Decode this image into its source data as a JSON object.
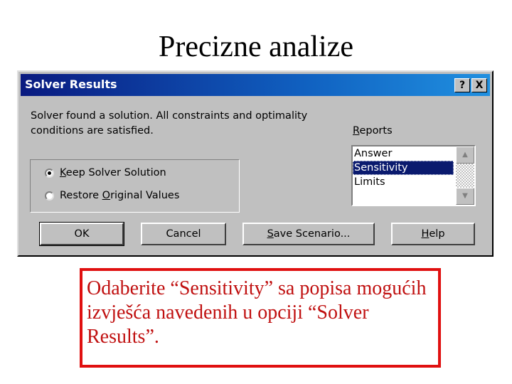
{
  "slide": {
    "title": "Precizne analize",
    "note": "Odaberite “Sensitivity” sa popisa mogućih izvješća navedenih u opciji “Solver Results”."
  },
  "dialog": {
    "title": "Solver Results",
    "help_icon": "?",
    "close_icon": "X",
    "message_line1": "Solver found a solution.  All constraints and optimality",
    "message_line2": "conditions are satisfied.",
    "options": [
      {
        "accel": "K",
        "rest": "eep Solver Solution",
        "selected": true
      },
      {
        "pre": "Restore ",
        "accel": "O",
        "rest": "riginal Values",
        "selected": false
      }
    ],
    "reports": {
      "label_accel": "R",
      "label_rest": "eports",
      "items": [
        "Answer",
        "Sensitivity",
        "Limits"
      ],
      "selected": "Sensitivity"
    },
    "buttons": {
      "ok": "OK",
      "cancel": "Cancel",
      "save_accel": "S",
      "save_rest": "ave Scenario...",
      "help_accel": "H",
      "help_rest": "elp"
    }
  },
  "colors": {
    "titlebar_start": "#0a1a80",
    "titlebar_end": "#2090e0",
    "dialog_face": "#c0c0c0",
    "selection": "#0a1a6e",
    "note_text": "#c01010",
    "note_border": "#e01010"
  }
}
